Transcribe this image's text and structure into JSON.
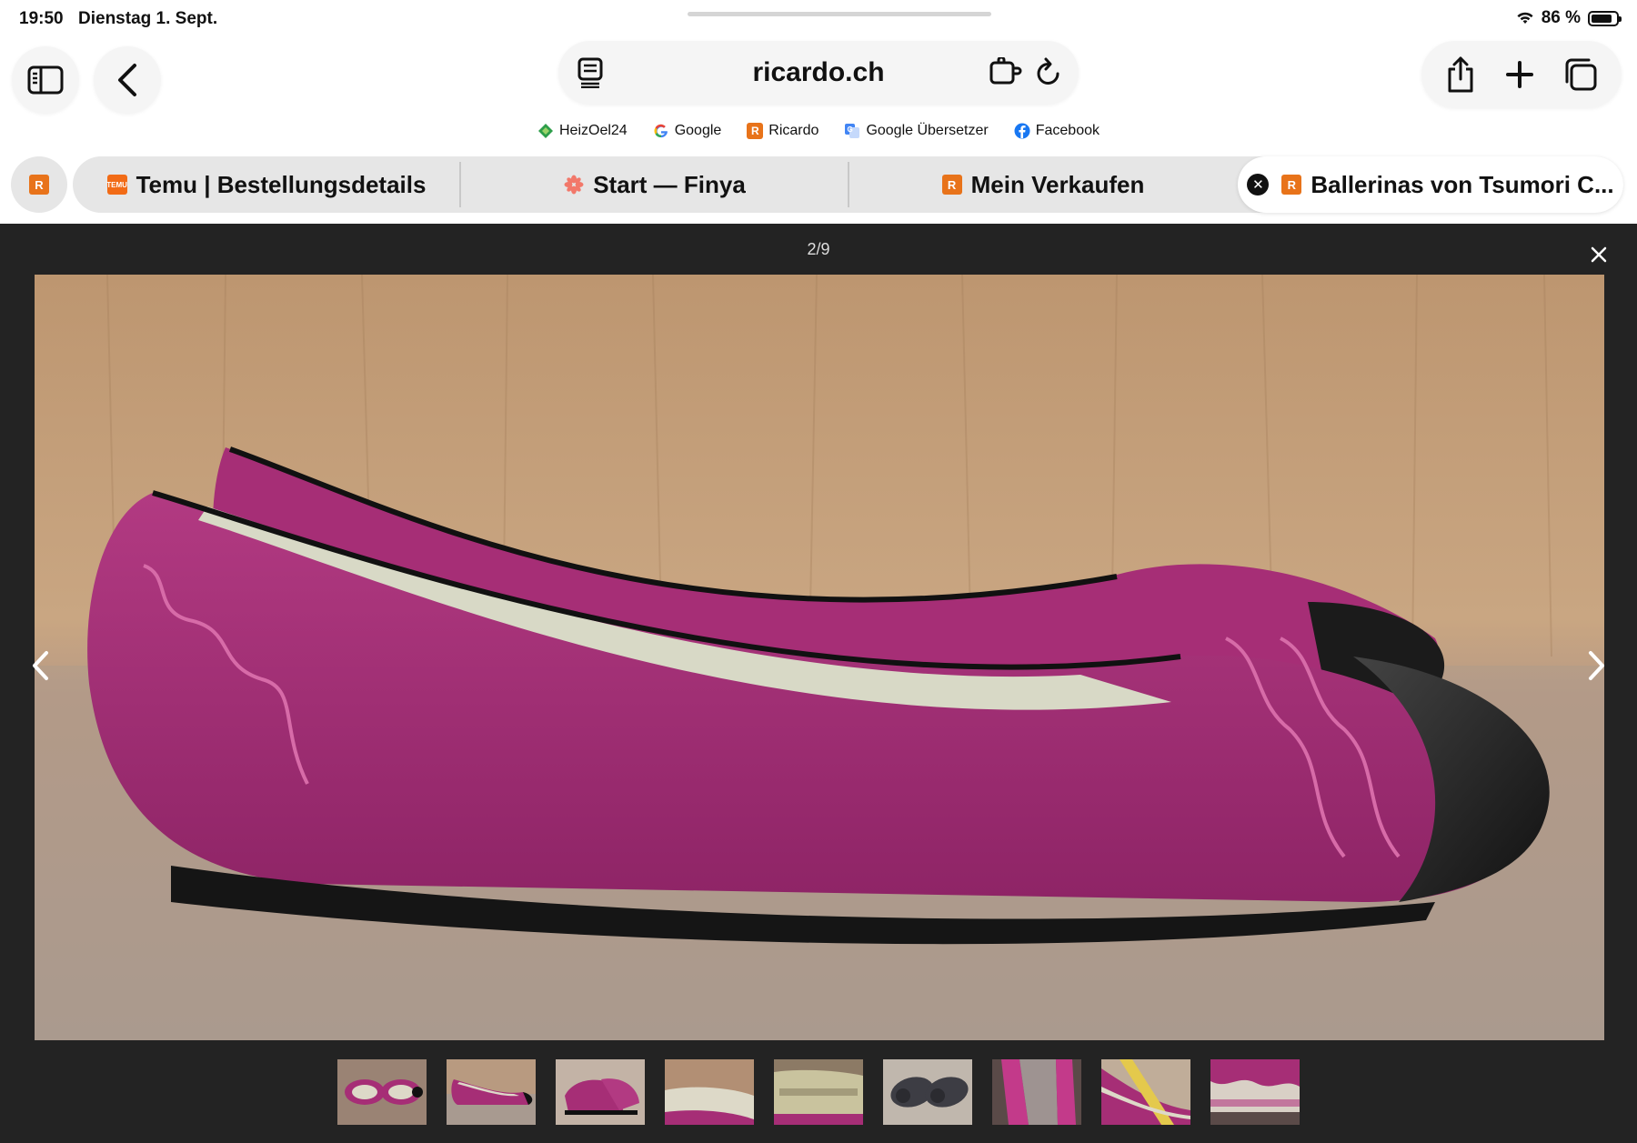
{
  "status": {
    "time": "19:50",
    "date": "Dienstag 1. Sept.",
    "battery": "86 %",
    "battery_level": 0.86
  },
  "toolbar": {
    "url": "ricardo.ch",
    "icons": [
      "sidebar-icon",
      "back-icon",
      "reader-icon",
      "extension-icon",
      "reload-icon",
      "share-icon",
      "new-tab-icon",
      "tabs-overview-icon"
    ]
  },
  "favorites": [
    {
      "label": "HeizOel24",
      "icon": "heizoel-icon",
      "color": "#2e9e4a"
    },
    {
      "label": "Google",
      "icon": "google-icon",
      "color": "#4285f4"
    },
    {
      "label": "Ricardo",
      "icon": "ricardo-icon",
      "color": "#e8731a"
    },
    {
      "label": "Google Übersetzer",
      "icon": "translate-icon",
      "color": "#4285f4"
    },
    {
      "label": "Facebook",
      "icon": "facebook-icon",
      "color": "#1877f2"
    }
  ],
  "tabs": [
    {
      "label": "Temu | Bestellungsdetails",
      "icon": "temu-icon",
      "color": "#f26b16"
    },
    {
      "label": "Start — Finya",
      "icon": "finya-icon",
      "color": "#f2786a"
    },
    {
      "label": "Mein Verkaufen",
      "icon": "ricardo-icon",
      "color": "#e8731a"
    },
    {
      "label": "Ballerinas von Tsumori C...",
      "icon": "ricardo-icon",
      "color": "#e8731a",
      "active": true
    }
  ],
  "gallery": {
    "counter": "2/9",
    "selected_index": 1,
    "thumbnail_count": 9
  },
  "colors": {
    "accent": "#1f9aa5",
    "lightbox_bg": "#232323",
    "ricardo": "#e8731a"
  }
}
